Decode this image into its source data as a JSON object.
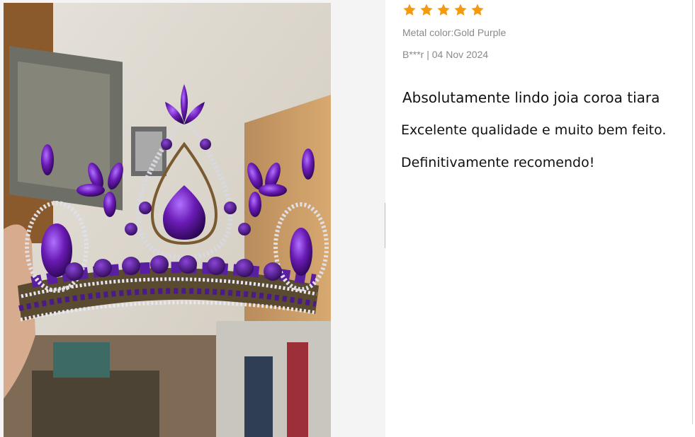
{
  "review": {
    "rating": 5,
    "star_color": "#f59a0c",
    "metal_color": "Metal color:Gold Purple",
    "author_date": "B***r | 04 Nov 2024",
    "lines": [
      "Absolutamente lindo joia coroa tiara",
      "Excelente qualidade e muito bem feito.",
      "Definitivamente recomendo!"
    ]
  },
  "photo": {
    "subject": "purple-crystal-crown-tiara",
    "gem_color": "#6a1bb5",
    "metal_color": "#6e5a3a"
  },
  "icons": {
    "star": "star-icon"
  }
}
